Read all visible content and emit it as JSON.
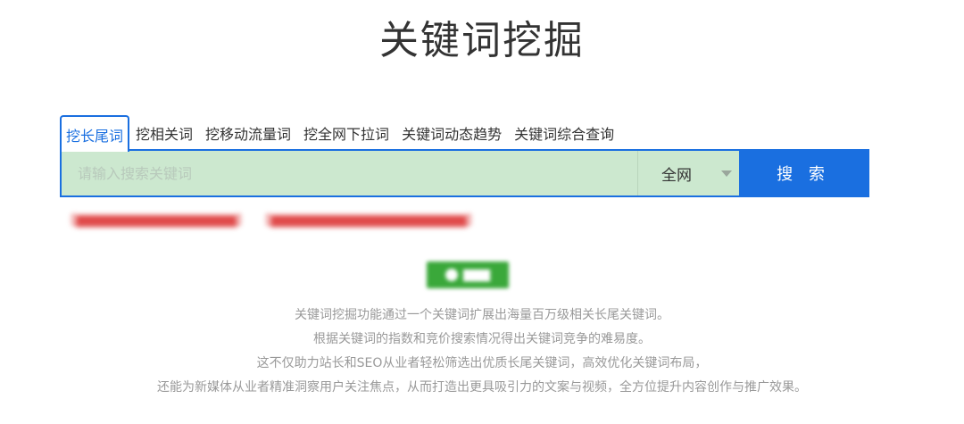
{
  "title": "关键词挖掘",
  "tabs": [
    {
      "label": "挖长尾词",
      "active": true
    },
    {
      "label": "挖相关词",
      "active": false
    },
    {
      "label": "挖移动流量词",
      "active": false
    },
    {
      "label": "挖全网下拉词",
      "active": false
    },
    {
      "label": "关键词动态趋势",
      "active": false
    },
    {
      "label": "关键词综合查询",
      "active": false
    }
  ],
  "search": {
    "placeholder": "请输入搜索关键词",
    "value": "",
    "scope": "全网",
    "button_label": "搜 索"
  },
  "colors": {
    "accent": "#1a6fe0",
    "input_bg": "#cce8cf",
    "badge_green": "#3aa83a",
    "promo_red": "#e04a4a"
  },
  "icons": {
    "scope_caret": "chevron-down-icon",
    "badge_icon": "wechat-icon"
  },
  "description": [
    "关键词挖掘功能通过一个关键词扩展出海量百万级相关长尾关键词。",
    "根据关键词的指数和竞价搜索情况得出关键词竞争的难易度。",
    "这不仅助力站长和SEO从业者轻松筛选出优质长尾关键词，高效优化关键词布局，",
    "还能为新媒体从业者精准洞察用户关注焦点，从而打造出更具吸引力的文案与视频，全方位提升内容创作与推广效果。"
  ]
}
